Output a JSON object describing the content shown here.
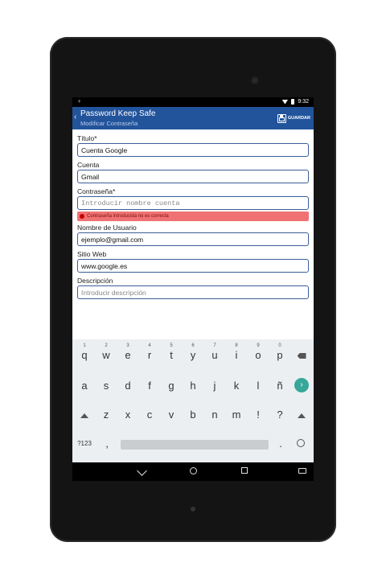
{
  "status_bar": {
    "time": "9:32"
  },
  "action_bar": {
    "title": "Password Keep Safe",
    "subtitle": "Modificar Contraseña",
    "save_label": "GUARDAR"
  },
  "form": {
    "titulo": {
      "label": "Título*",
      "value": "Cuenta Google"
    },
    "cuenta": {
      "label": "Cuenta",
      "value": "Gmail"
    },
    "contrasena": {
      "label": "Contraseña*",
      "placeholder": "Introducir nombre cuenta"
    },
    "error": "Contraseña introducida no es correcta",
    "usuario": {
      "label": "Nombre de Usuario",
      "value": "ejemplo@gmail.com"
    },
    "web": {
      "label": "Sitio Web",
      "value": "www.google.es"
    },
    "descripcion": {
      "label": "Descripción",
      "placeholder": "Introducir descripción"
    }
  },
  "keyboard": {
    "row1": [
      "q",
      "w",
      "e",
      "r",
      "t",
      "y",
      "u",
      "i",
      "o",
      "p"
    ],
    "row1_hints": [
      "1",
      "2",
      "3",
      "4",
      "5",
      "6",
      "7",
      "8",
      "9",
      "0"
    ],
    "row2": [
      "a",
      "s",
      "d",
      "f",
      "g",
      "h",
      "j",
      "k",
      "l",
      "ñ"
    ],
    "row3": [
      "z",
      "x",
      "c",
      "v",
      "b",
      "n",
      "m",
      "!",
      "?"
    ],
    "symbols_key": "?123",
    "comma": ",",
    "period": "."
  },
  "colors": {
    "action_bar": "#22549c",
    "error": "#f07272",
    "enter": "#36a79a"
  }
}
